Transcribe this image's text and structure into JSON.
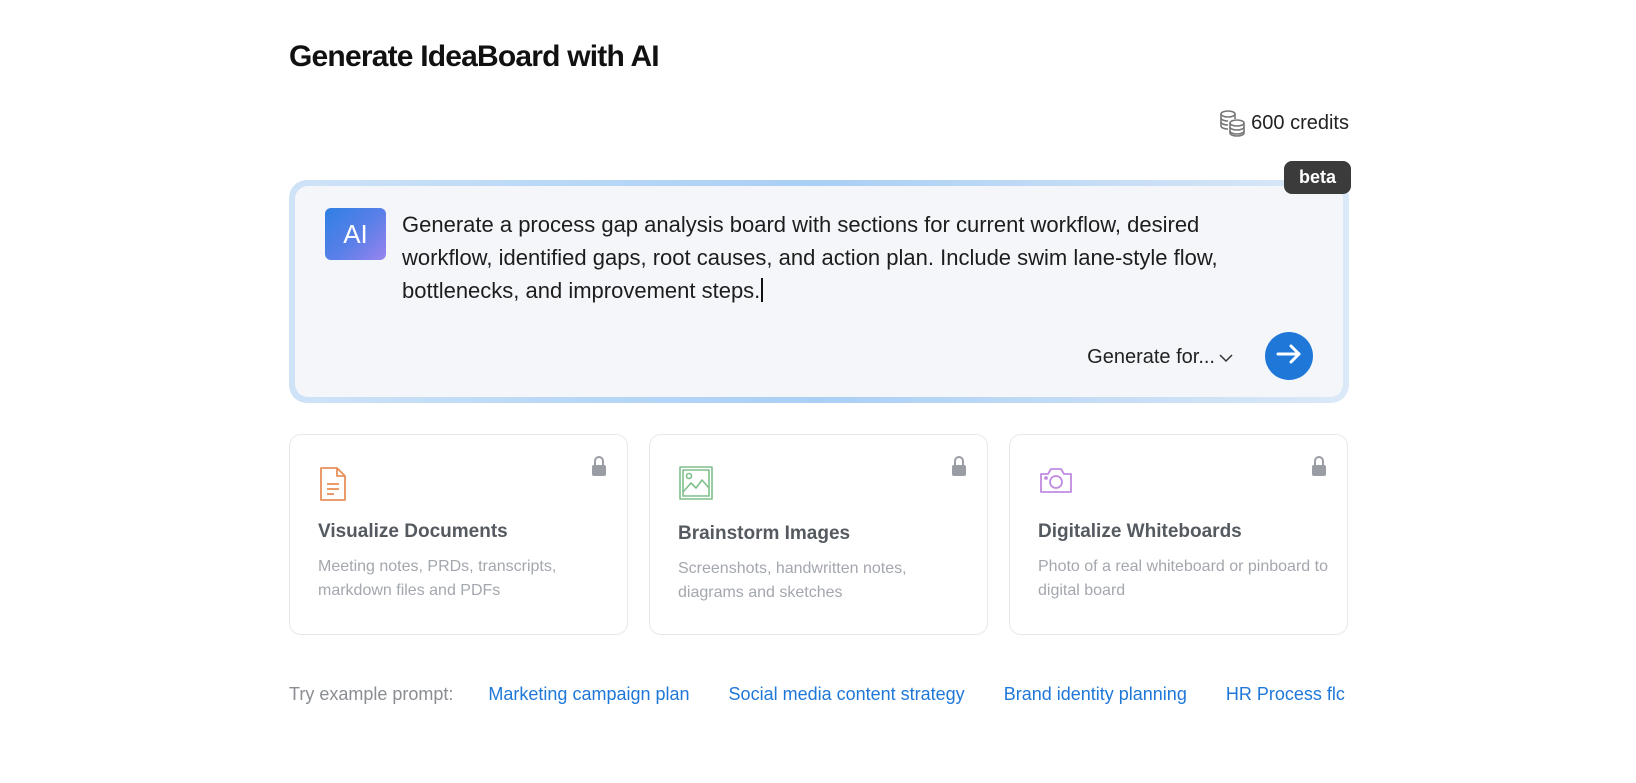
{
  "header": {
    "title": "Generate IdeaBoard with AI"
  },
  "credits": {
    "icon": "coins-stack-icon",
    "label": "600 credits"
  },
  "prompt": {
    "badge_text": "AI",
    "beta_label": "beta",
    "text": "Generate a process gap analysis board with sections for current workflow, desired workflow, identified gaps, root causes, and action plan. Include swim lane-style flow, bottlenecks, and improvement steps.",
    "generate_for_label": "Generate for...",
    "send_icon": "arrow-right-icon",
    "accent_color": "#1f78d8"
  },
  "cards": [
    {
      "icon": "document-icon",
      "title": "Visualize Documents",
      "description": "Meeting notes, PRDs, transcripts, markdown files and PDFs",
      "locked": true,
      "icon_color": "#e8905a"
    },
    {
      "icon": "image-icon",
      "title": "Brainstorm Images",
      "description": "Screenshots, handwritten notes, diagrams and sketches",
      "locked": true,
      "icon_color": "#7fbf8c"
    },
    {
      "icon": "camera-icon",
      "title": "Digitalize Whiteboards",
      "description": "Photo of a real whiteboard or pinboard to digital board",
      "locked": true,
      "icon_color": "#c08be0"
    }
  ],
  "examples": {
    "label": "Try example prompt:",
    "items": [
      "Marketing campaign plan",
      "Social media content strategy",
      "Brand identity planning",
      "HR Process flc"
    ]
  }
}
